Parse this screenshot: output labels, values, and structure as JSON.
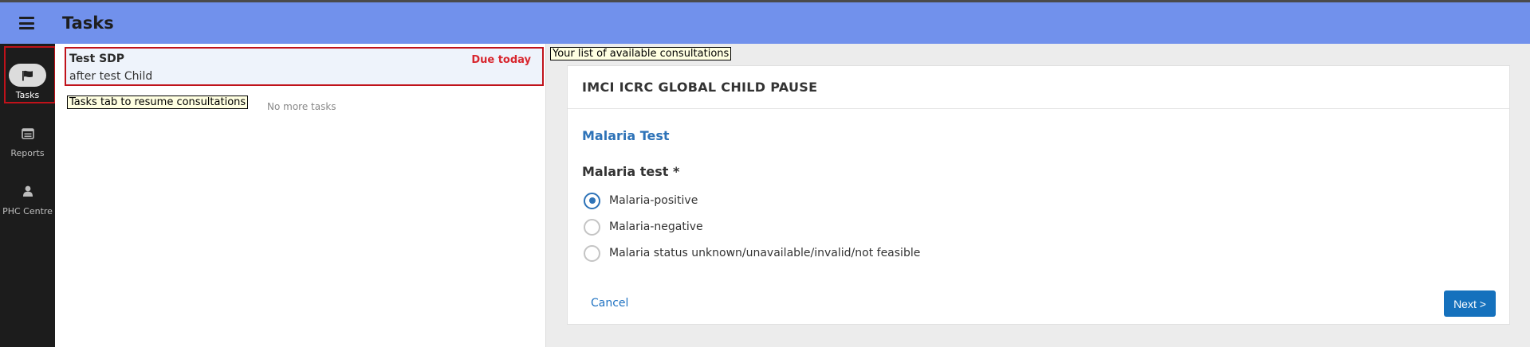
{
  "header": {
    "title": "Tasks",
    "menu_icon": "hamburger-menu-icon",
    "color": "#7191ec"
  },
  "sidebar": {
    "items": [
      {
        "label": "Tasks",
        "icon": "flag-icon",
        "active": true
      },
      {
        "label": "Reports",
        "icon": "report-icon",
        "active": false
      },
      {
        "label": "PHC Centre",
        "icon": "person-icon",
        "active": false
      }
    ]
  },
  "tasks": {
    "items": [
      {
        "title": "Test SDP",
        "subtitle": "after test Child",
        "due": "Due today"
      }
    ],
    "empty_text": "No more tasks",
    "tooltip_left": "Tasks tab to resume consultations",
    "tooltip_right": "Your list of available consultations"
  },
  "form": {
    "title": "IMCI ICRC GLOBAL CHILD PAUSE",
    "section": "Malaria Test",
    "question": "Malaria test *",
    "options": [
      {
        "label": "Malaria-positive",
        "selected": true
      },
      {
        "label": "Malaria-negative",
        "selected": false
      },
      {
        "label": "Malaria status unknown/unavailable/invalid/not feasible",
        "selected": false
      }
    ],
    "cancel_label": "Cancel",
    "next_label": "Next >"
  },
  "colors": {
    "accent": "#2e73b8",
    "due": "#d8262e",
    "button": "#1571bd",
    "highlight": "#c0121a"
  }
}
